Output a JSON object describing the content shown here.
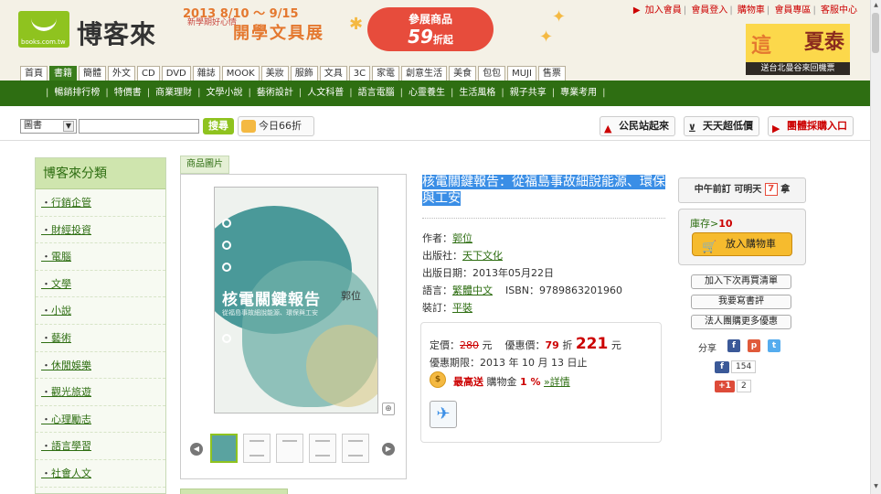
{
  "header": {
    "logo_url_text": "books.com.tw",
    "logo_text": "博客來",
    "banner_dates": "2013 8/10 ～ 9/15",
    "banner_side": "新學期好心情",
    "banner_title": "開學文具展",
    "promo_line1": "參展商品",
    "promo_line2": "59",
    "promo_line2_suffix": "折起",
    "top_links": [
      "加入會員",
      "會員登入",
      "購物車",
      "會員專區",
      "客服中心"
    ],
    "side_ad_text1": "這",
    "side_ad_text2": "夏泰",
    "side_ad_footer": "送台北曼谷來回機票"
  },
  "nav_tabs": [
    "首頁",
    "書籍",
    "簡體",
    "外文",
    "CD",
    "DVD",
    "雜誌",
    "MOOK",
    "美妝",
    "服飾",
    "文具",
    "3C",
    "家電",
    "創意生活",
    "美食",
    "包包",
    "MUJI",
    "售票"
  ],
  "active_nav_tab": "書籍",
  "category_bar": [
    "暢銷排行榜",
    "特價書",
    "商業理財",
    "文學小說",
    "藝術設計",
    "人文科普",
    "語言電腦",
    "心靈養生",
    "生活風格",
    "親子共享",
    "專業考用"
  ],
  "search": {
    "select_value": "圖書",
    "input_value": "",
    "button_label": "搜尋",
    "discount_label": "今日66折"
  },
  "right_buttons": {
    "citizen": "公民站起來",
    "lowest": "天天超低價",
    "group_buy": "團體採購入口"
  },
  "sidebar": {
    "heading": "博客來分類",
    "items": [
      "行銷企管",
      "財經投資",
      "電腦",
      "文學",
      "小說",
      "藝術",
      "休閒娛樂",
      "觀光旅遊",
      "心理勵志",
      "語言學習",
      "社會人文"
    ]
  },
  "product": {
    "image_tab": "商品圖片",
    "cover_title": "核電關鍵報告",
    "cover_author": "郭位",
    "cover_subtitle": "從福島事故細說能源、環保與工安",
    "title": "核電關鍵報告：從福島事故細說能源、環保與工安",
    "author_label": "作者：",
    "author": "郭位",
    "publisher_label": "出版社：",
    "publisher": "天下文化",
    "date_label": "出版日期：",
    "date": "2013年05月22日",
    "language_label": "語言：",
    "language": "繁體中文",
    "isbn_label": "ISBN：",
    "isbn": "9789863201960",
    "binding_label": "裝訂：",
    "binding": "平裝"
  },
  "price": {
    "list_label": "定價：",
    "list_price": "280",
    "currency": "元",
    "sale_label": "優惠價：",
    "discount": "79",
    "discount_unit": "折",
    "sale_price": "221",
    "period_label": "優惠期限：",
    "period": "2013 年 10 月 13 日止",
    "coin_icon": "$",
    "bonus_label": "最高送",
    "bonus_text": "購物金",
    "bonus_value": "1 %",
    "bonus_link": "»詳情"
  },
  "purchase": {
    "delivery": "中午前訂 可明天",
    "delivery_store_mark": "7",
    "delivery_suffix": "拿",
    "stock_label": "庫存>",
    "stock_value": "10",
    "cart_label": "放入購物車",
    "wishlist": "加入下次再買清單",
    "review": "我要寫書評",
    "corporate": "法人團購更多優惠",
    "share_label": "分享",
    "fb_count": "154",
    "gplus_count": "2"
  },
  "colors": {
    "brand_green": "#8fc31f",
    "nav_green": "#2e6e12",
    "price_red": "#cc0000",
    "highlight_blue": "#3a8ee6",
    "cart_orange": "#f6bb2e"
  }
}
